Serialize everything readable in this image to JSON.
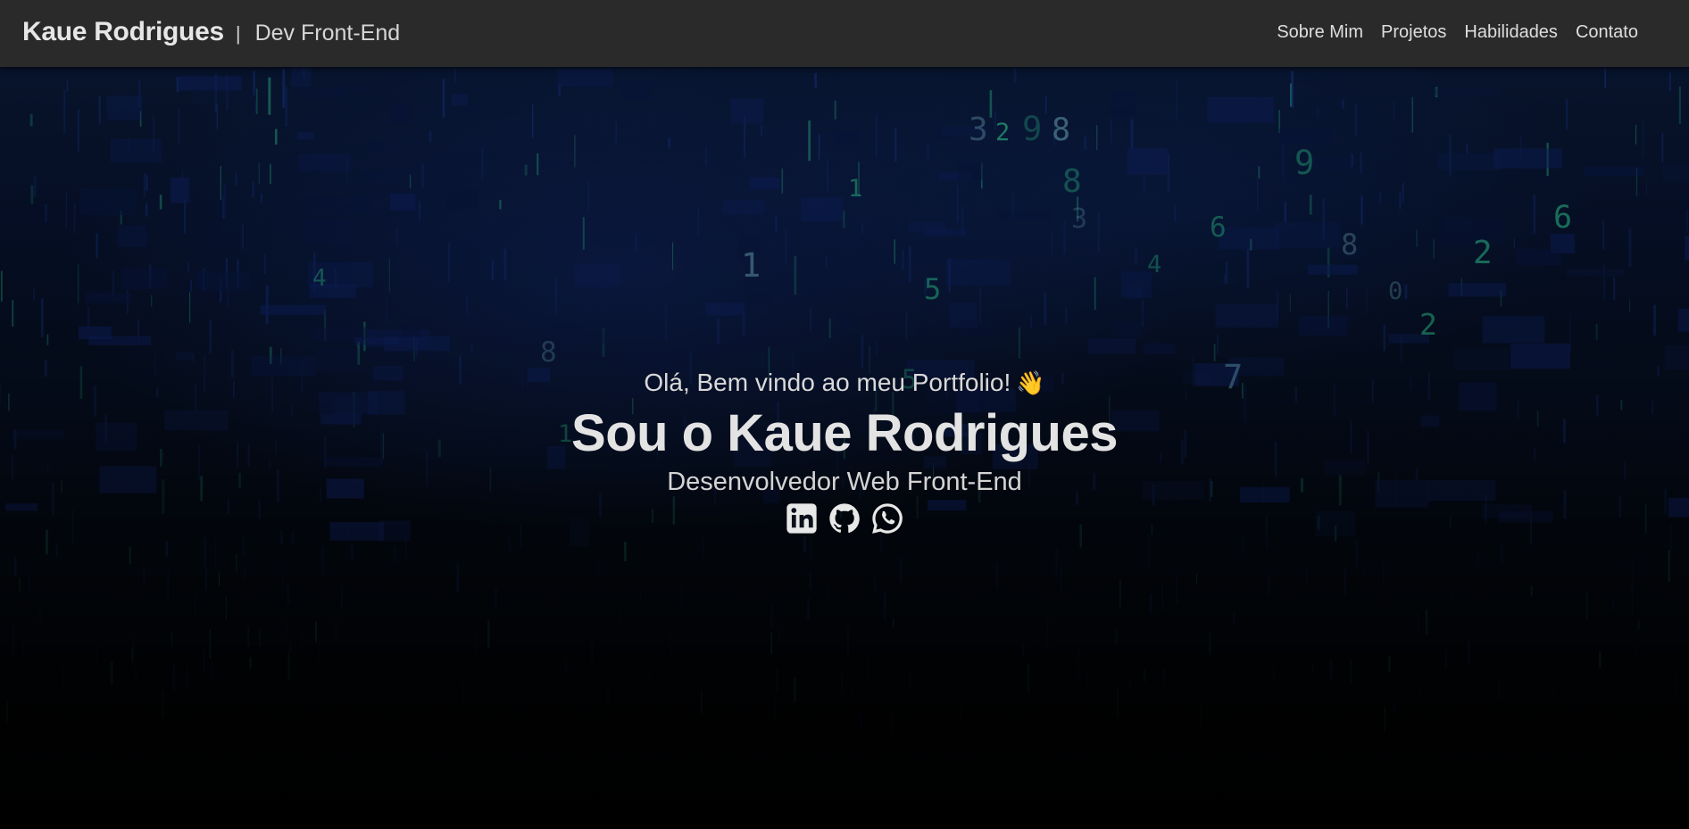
{
  "navbar": {
    "brand_name": "Kaue Rodrigues",
    "separator": "|",
    "brand_role": "Dev Front-End",
    "links": [
      {
        "label": "Sobre Mim"
      },
      {
        "label": "Projetos"
      },
      {
        "label": "Habilidades"
      },
      {
        "label": "Contato"
      }
    ]
  },
  "hero": {
    "greeting": "Olá, Bem vindo ao meu Portfolio!",
    "greeting_emoji": "👋",
    "headline": "Sou o Kaue Rodrigues",
    "subtitle": "Desenvolvedor Web Front-End",
    "socials": [
      {
        "icon": "linkedin-icon"
      },
      {
        "icon": "github-icon"
      },
      {
        "icon": "whatsapp-icon"
      }
    ],
    "background_glyphs": [
      "3",
      "2",
      "9",
      "8",
      "1",
      "6",
      "8",
      "2",
      "4",
      "8",
      "5",
      "1",
      "7",
      "2",
      "8",
      "3",
      "5",
      "6",
      "1",
      "9",
      "4",
      "0"
    ]
  },
  "colors": {
    "navbar_bg": "#2a2a2a",
    "text": "#e3e3e3",
    "matrix_green": "#2fd6a0",
    "matrix_blue": "#1e3fa8"
  }
}
